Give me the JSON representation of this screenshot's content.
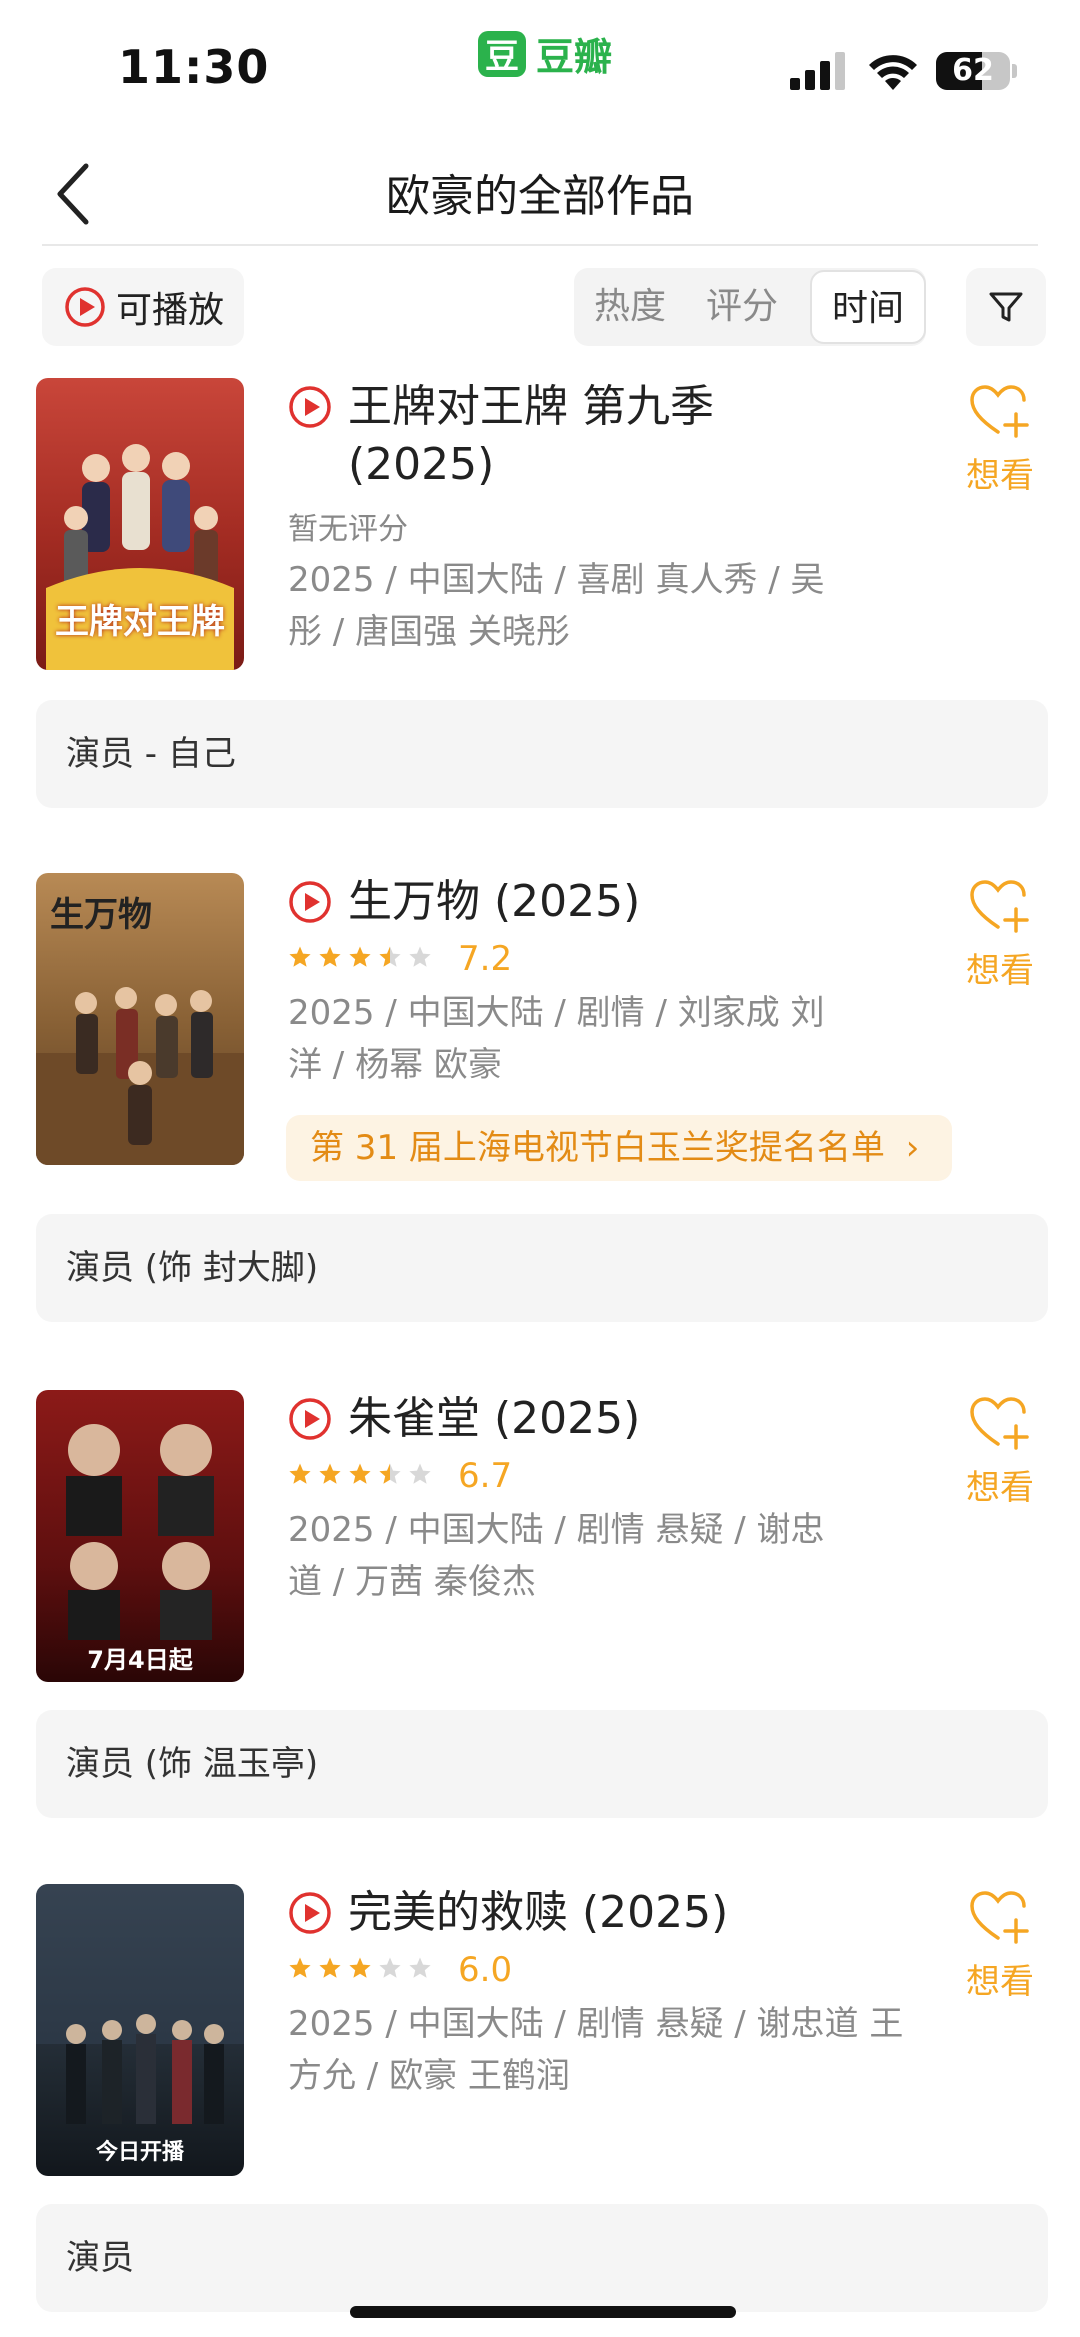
{
  "status_bar": {
    "time": "11:30",
    "app_badge": "豆",
    "app_name": "豆瓣",
    "battery": "62",
    "battery_level": 0.62
  },
  "nav": {
    "title": "欧豪的全部作品"
  },
  "filters": {
    "playable_label": "可播放",
    "sort_tabs": [
      "热度",
      "评分",
      "时间"
    ],
    "active_sort": "时间"
  },
  "want_label": "想看",
  "colors": {
    "accent_orange": "#f5a623",
    "douban_green": "#2bb24c",
    "play_red": "#e0322f"
  },
  "items": [
    {
      "title": "王牌对王牌 第九季 (2025)",
      "rating_text": "暂无评分",
      "meta": "2025 / 中国大陆 / 喜剧 真人秀 / 吴彤 / 唐国强 关晓彤",
      "role": "演员 - 自己",
      "poster_text": "王牌对王牌"
    },
    {
      "title": "生万物 (2025)",
      "stars": 3.5,
      "score": "7.2",
      "meta": "2025 / 中国大陆 / 剧情 / 刘家成 刘洋 / 杨幂 欧豪",
      "award": "第 31 届上海电视节白玉兰奖提名名单",
      "role": "演员 (饰 封大脚)",
      "poster_text": "生万物"
    },
    {
      "title": "朱雀堂 (2025)",
      "stars": 3.5,
      "score": "6.7",
      "meta": "2025 / 中国大陆 / 剧情 悬疑 / 谢忠道 / 万茜 秦俊杰",
      "role": "演员 (饰 温玉亭)",
      "poster_text": "7月4日起"
    },
    {
      "title": "完美的救赎 (2025)",
      "stars": 3,
      "score": "6.0",
      "meta": "2025 / 中国大陆 / 剧情 悬疑 / 谢忠道 王方允 / 欧豪 王鹤润",
      "role": "演员",
      "poster_text": "今日开播"
    }
  ]
}
